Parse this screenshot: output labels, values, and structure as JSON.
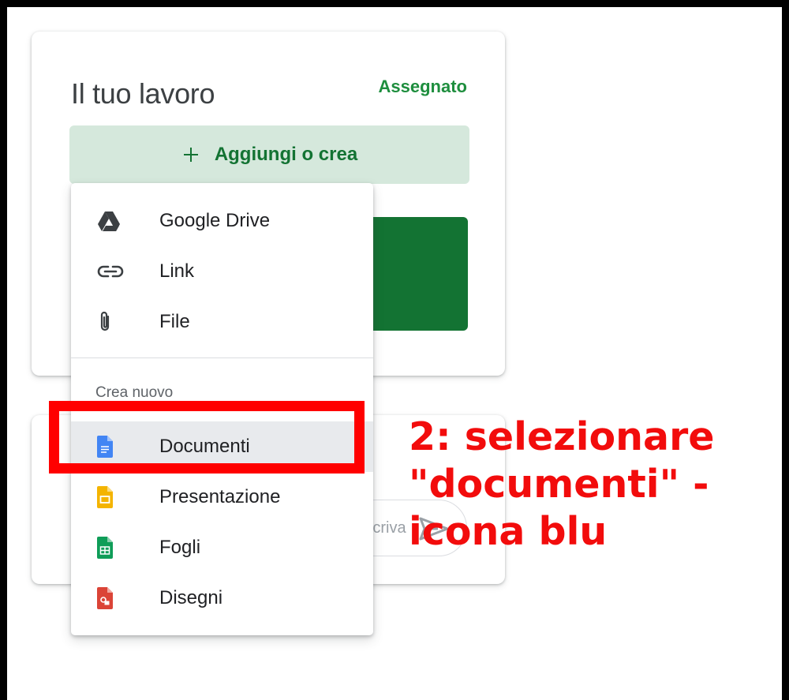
{
  "work_card": {
    "title": "Il tuo lavoro",
    "status": "Assegnato",
    "add_label": "Aggiungi o crea",
    "accent_color": "#137333"
  },
  "comment_card": {
    "placeholder": "Scriva"
  },
  "menu": {
    "items": [
      {
        "label": "Google Drive",
        "icon": "google-drive-icon"
      },
      {
        "label": "Link",
        "icon": "link-icon"
      },
      {
        "label": "File",
        "icon": "paperclip-icon"
      }
    ],
    "section_label": "Crea nuovo",
    "create_items": [
      {
        "label": "Documenti",
        "icon": "google-docs-icon",
        "color": "#4285f4"
      },
      {
        "label": "Presentazione",
        "icon": "google-slides-icon",
        "color": "#f4b400"
      },
      {
        "label": "Fogli",
        "icon": "google-sheets-icon",
        "color": "#0f9d58"
      },
      {
        "label": "Disegni",
        "icon": "google-drawings-icon",
        "color": "#db4437"
      }
    ]
  },
  "annotation": {
    "text": "2: selezionare\n\"documenti\" -\nicona blu",
    "color": "#f20c0c"
  }
}
